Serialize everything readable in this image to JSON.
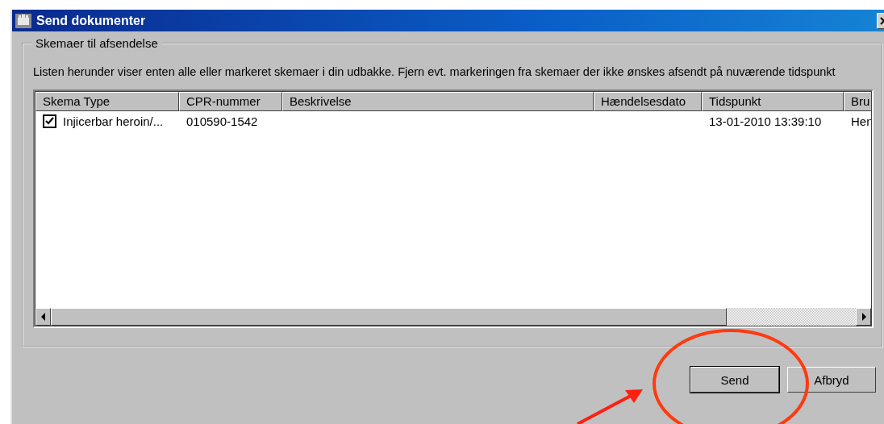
{
  "window": {
    "title": "Send dokumenter"
  },
  "group": {
    "title": "Skemaer til afsendelse",
    "description": "Listen herunder viser enten alle eller markeret skemaer i din udbakke. Fjern evt. markeringen fra skemaer der ikke ønskes afsendt på nuværende tidspunkt"
  },
  "table": {
    "columns": [
      "Skema Type",
      "CPR-nummer",
      "Beskrivelse",
      "Hændelsesdato",
      "Tidspunkt",
      "Bru"
    ],
    "rows": [
      {
        "checked": true,
        "cells": [
          "Injicerbar heroin/...",
          "010590-1542",
          "",
          "",
          "13-01-2010 13:39:10",
          "Hen"
        ]
      }
    ]
  },
  "buttons": [
    "Send",
    "Afbryd"
  ]
}
